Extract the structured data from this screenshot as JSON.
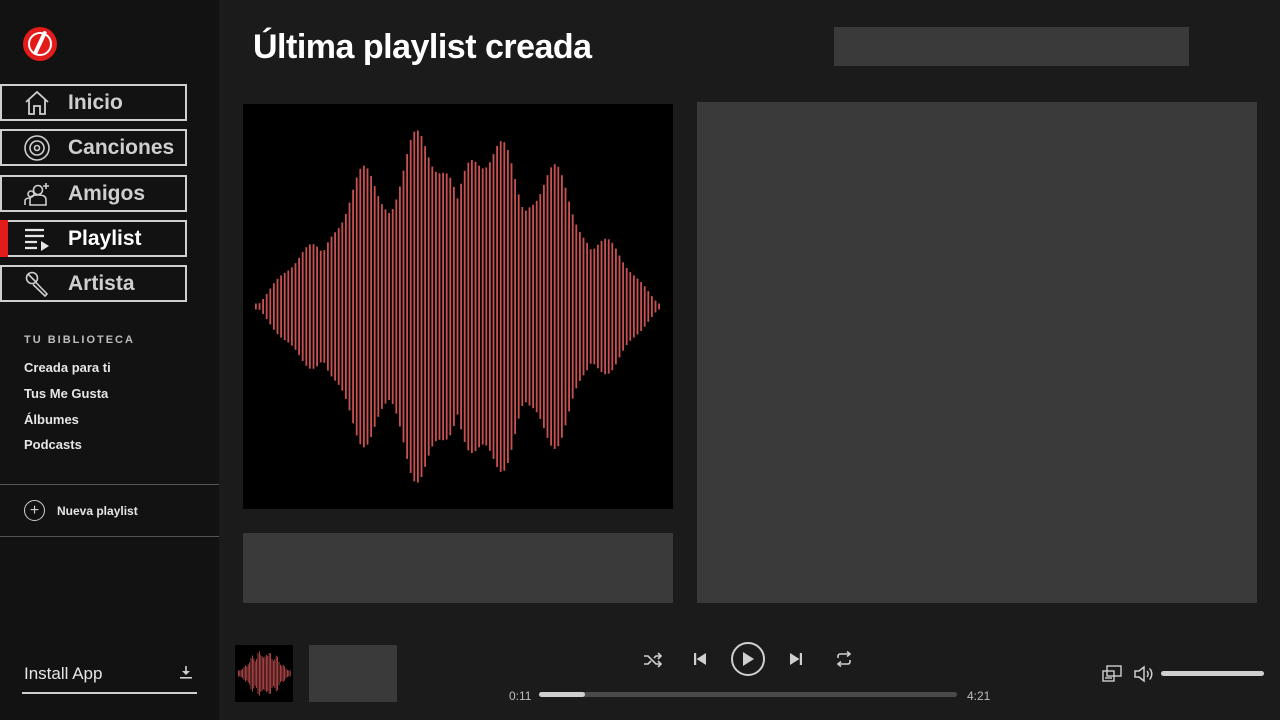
{
  "app": {
    "brand_color": "#e31b1b",
    "background": "#1b1b1b",
    "sidebar_bg": "#121212",
    "panel_color": "#3a3a3a"
  },
  "sidebar": {
    "logo_icon": "vinyl-logo-icon",
    "nav": [
      {
        "label": "Inicio",
        "icon": "home-icon",
        "active": false
      },
      {
        "label": "Canciones",
        "icon": "disc-icon",
        "active": false
      },
      {
        "label": "Amigos",
        "icon": "add-friend-icon",
        "active": false
      },
      {
        "label": "Playlist",
        "icon": "playlist-icon",
        "active": true
      },
      {
        "label": "Artista",
        "icon": "microphone-icon",
        "active": false
      }
    ],
    "library": {
      "title": "TU BIBLIOTECA",
      "items": [
        "Creada para ti",
        "Tus Me Gusta",
        "Álbumes",
        "Podcasts"
      ]
    },
    "new_playlist_label": "Nueva playlist",
    "install_label": "Install App"
  },
  "main": {
    "title": "Última playlist creada",
    "search": {
      "value": "",
      "placeholder": ""
    }
  },
  "player": {
    "elapsed": "0:11",
    "duration": "4:21",
    "progress_fraction": 0.11,
    "volume_fraction": 1.0,
    "controls": [
      "shuffle-icon",
      "previous-icon",
      "play-icon",
      "next-icon",
      "repeat-icon"
    ],
    "right_icons": [
      "devices-icon",
      "volume-icon"
    ]
  }
}
